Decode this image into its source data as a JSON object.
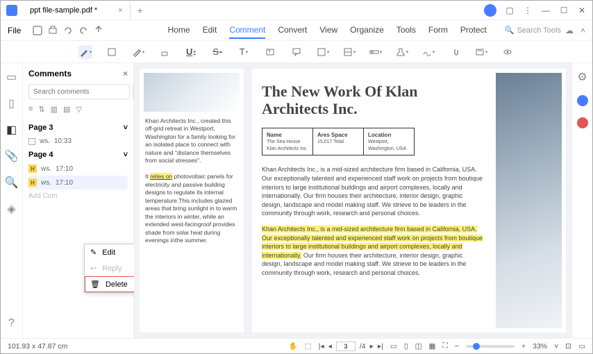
{
  "titlebar": {
    "filename": "ppt file-sample.pdf *"
  },
  "menubar": {
    "file": "File",
    "tabs": [
      "Home",
      "Edit",
      "Comment",
      "Convert",
      "View",
      "Organize",
      "Tools",
      "Form",
      "Protect"
    ],
    "active": "Comment",
    "search": "Search Tools"
  },
  "comments": {
    "title": "Comments",
    "search_placeholder": "Search comments",
    "pages": [
      {
        "label": "Page 3",
        "items": [
          {
            "badge": "",
            "user": "ws.",
            "time": "10:33"
          }
        ]
      },
      {
        "label": "Page 4",
        "items": [
          {
            "badge": "H",
            "user": "ws.",
            "time": "17:10"
          },
          {
            "badge": "H",
            "user": "ws.",
            "time": "17:10",
            "sel": true
          }
        ]
      }
    ],
    "add": "Add Com"
  },
  "context": {
    "edit": "Edit",
    "reply": "Reply",
    "delete": "Delete"
  },
  "doc": {
    "left_text": "Khan Architects Inc., created this off-grid retreat in Westport, Washington for a family looking for an isolated place to connect with nature and \"distance themselves from social stresses\".",
    "left_text2_pre": "It ",
    "left_text2_hl": "relies on",
    "left_text2_post": " photovoltaic panels for electricity and passive building designs to regulate its internal temperature.This includes glazed areas that bring sunlight in to warm the interiors in winter, while an extended west-facingroof provides shade from solar heat during evenings inthe summer.",
    "title": "The New Work Of Klan Architects Inc.",
    "table": {
      "c1h": "Name",
      "c1v": "The Sea House Klan Architects Inc",
      "c2h": "Ares Space",
      "c2v": "15,017 Total",
      "c3h": "Location",
      "c3v": "Westport, Washington, USA"
    },
    "p1": "Khan Architects Inc., is a mid-sized architecture firm based in California, USA. Our exceptionally talented and experienced staff work on projects from boutique interiors to large institutional buildings and airport complexes, locally and internationally. Our firm houses their architecture, interior design, graphic design, landscape and model making staff. We strieve to be leaders in the community through work, research and personal choices.",
    "p2_hl": "Khan Architects Inc., is a mid-sized architecture firm based in California, USA. Our exceptionally talented and experienced staff work on projects from boutique interiors to large institutional buildings and airport complexes, locally and internationally.",
    "p2_post": " Our firm houses their architecture, interior design, graphic design, landscape and model making staff. We strieve to be leaders in the community through work, research and personal choices."
  },
  "statusbar": {
    "dims": "101.93 x 47.87 cm",
    "page_current": "3",
    "page_total": "/4",
    "zoom": "33%"
  }
}
